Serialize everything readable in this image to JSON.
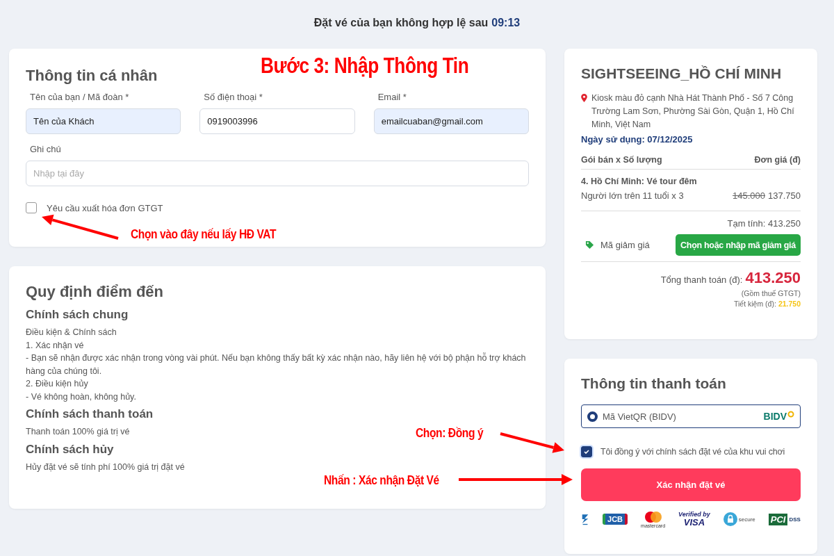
{
  "timer": {
    "text": "Đặt vé của bạn không hợp lệ sau",
    "time": "09:13"
  },
  "personal_info": {
    "title": "Thông tin cá nhân",
    "fields": [
      {
        "label": "Tên của bạn / Mã đoàn *",
        "value": "Tên của Khách",
        "autofilled": true
      },
      {
        "label": "Số điện thoại *",
        "value": "0919003996",
        "autofilled": false
      },
      {
        "label": "Email *",
        "value": "emailcuaban@gmail.com",
        "autofilled": true
      }
    ],
    "note": {
      "label": "Ghi chú",
      "placeholder": "Nhập tại đây"
    },
    "vat_invoice": {
      "label": "Yêu cầu xuất hóa đơn GTGT",
      "checked": false
    }
  },
  "rules": {
    "title": "Quy định điểm đến",
    "sections": [
      {
        "heading": "Chính sách chung",
        "lines": [
          "Điều kiện & Chính sách",
          "1. Xác nhận vé",
          "- Bạn sẽ nhận được xác nhận trong vòng vài phút. Nếu bạn không thấy bất kỳ xác nhận nào, hãy liên hệ với bộ phận hỗ trợ khách hàng của chúng tôi.",
          "2. Điều kiện hủy",
          "- Vé không hoàn, không hủy."
        ]
      },
      {
        "heading": "Chính sách thanh toán",
        "lines": [
          "Thanh toán 100% giá trị vé"
        ]
      },
      {
        "heading": "Chính sách hủy",
        "lines": [
          "Hủy đặt vé sẽ tính phí 100% giá trị đặt vé"
        ]
      }
    ]
  },
  "order": {
    "title": "SIGHTSEEING_HỒ CHÍ MINH",
    "address": "Kiosk màu đỏ cạnh Nhà Hát Thành Phố - Số 7 Công Trường Lam Sơn, Phường Sài Gòn, Quận 1, Hồ Chí Minh, Việt Nam",
    "usage_date": "Ngày sử dụng: 07/12/2025",
    "columns": [
      "Gói bán x Số lượng",
      "Đơn giá (đ)"
    ],
    "package": "4. Hồ Chí Minh: Vé tour đêm",
    "items": [
      {
        "name": "Người lớn trên 11 tuổi x 3",
        "old_price": "145.000",
        "price": "137.750"
      }
    ],
    "subtotal": "Tạm tính: 413.250",
    "discount": {
      "label": "Mã giảm giá",
      "button": "Chọn hoặc nhập mã giảm giá"
    },
    "total_label": "Tổng thanh toán (đ):",
    "total": "413.250",
    "tax_note": "(Gồm thuế GTGT)",
    "savings_label": "Tiết kiệm (đ):",
    "savings": "21.750"
  },
  "payment": {
    "title": "Thông tin thanh toán",
    "methods": [
      {
        "label": "Mã VietQR (BIDV)",
        "bank": "BIDV",
        "selected": true
      }
    ],
    "agree": {
      "label": "Tôi đồng ý với chính sách đặt vé của khu vui chơi",
      "checked": true
    },
    "confirm_button": "Xác nhận đặt vé",
    "logos": [
      {
        "kind": "napas"
      },
      {
        "kind": "jcb",
        "texts": [
          "JCB"
        ]
      },
      {
        "kind": "mastercard",
        "texts": [
          "mastercard"
        ]
      },
      {
        "kind": "visa",
        "texts": [
          "Verified by",
          "VISA"
        ]
      },
      {
        "kind": "secure",
        "texts": [
          "secure"
        ]
      },
      {
        "kind": "pci",
        "texts": [
          "PCI",
          "DSS"
        ]
      }
    ]
  },
  "annotations": [
    "Bước 3: Nhập Thông Tin",
    "Chọn vào đây nếu lấy HĐ VAT",
    "Chọn: Đồng ý",
    "Nhấn : Xác nhận Đặt Vé"
  ]
}
